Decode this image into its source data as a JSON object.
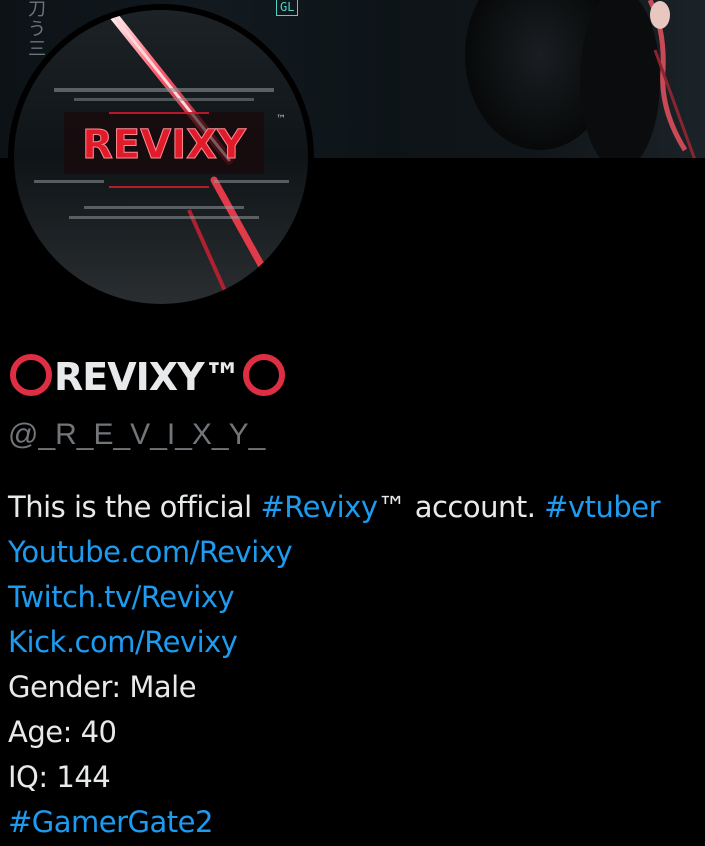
{
  "banner": {
    "glyphs": [
      "刀",
      "う",
      "三"
    ],
    "badge": "GL"
  },
  "avatar": {
    "logo_text": "REVIXY",
    "tm": "™",
    "colors": {
      "accent": "#dd2e44",
      "logo_red": "#e01b2a"
    }
  },
  "profile": {
    "name": "REVIXY™",
    "handle": "@_R_E_V_I_X_Y_",
    "ring_color": "#dd2e44"
  },
  "bio": {
    "line1": {
      "text_a": "This is the official ",
      "hashtag_a": "#Revixy",
      "text_b": "™ account. ",
      "hashtag_b": "#vtuber"
    },
    "links": [
      "Youtube.com/Revixy",
      "Twitch.tv/Revixy",
      "Kick.com/Revixy"
    ],
    "gender": "Gender: Male",
    "age": "Age: 40",
    "iq": "IQ: 144",
    "hashtag_last": "#GamerGate2"
  },
  "colors": {
    "background": "#000000",
    "text": "#e7e9ea",
    "secondary": "#71767b",
    "link": "#1d9bf0"
  }
}
